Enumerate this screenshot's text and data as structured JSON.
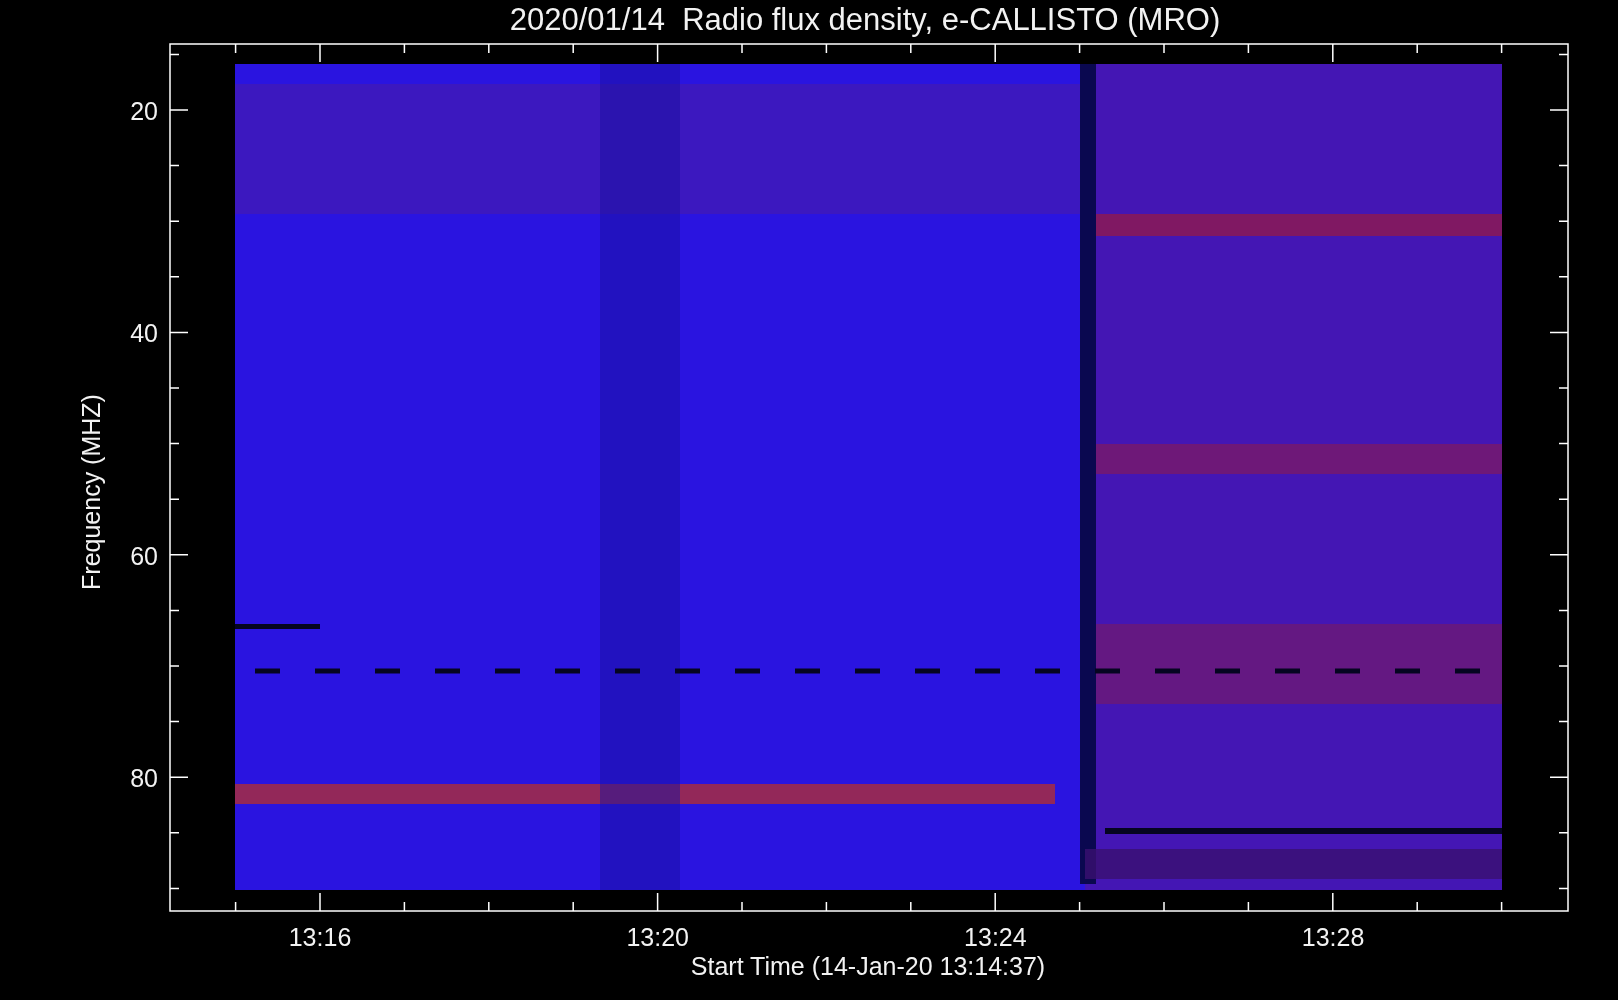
{
  "title": "2020/01/14  Radio flux density, e-CALLISTO (MRO)",
  "y_axis": {
    "label": "Frequency (MHZ)",
    "ticks": [
      "20",
      "40",
      "60",
      "80"
    ]
  },
  "x_axis": {
    "label": "Start Time (14-Jan-20 13:14:37)",
    "ticks": [
      "13:16",
      "13:20",
      "13:24",
      "13:28"
    ]
  }
}
